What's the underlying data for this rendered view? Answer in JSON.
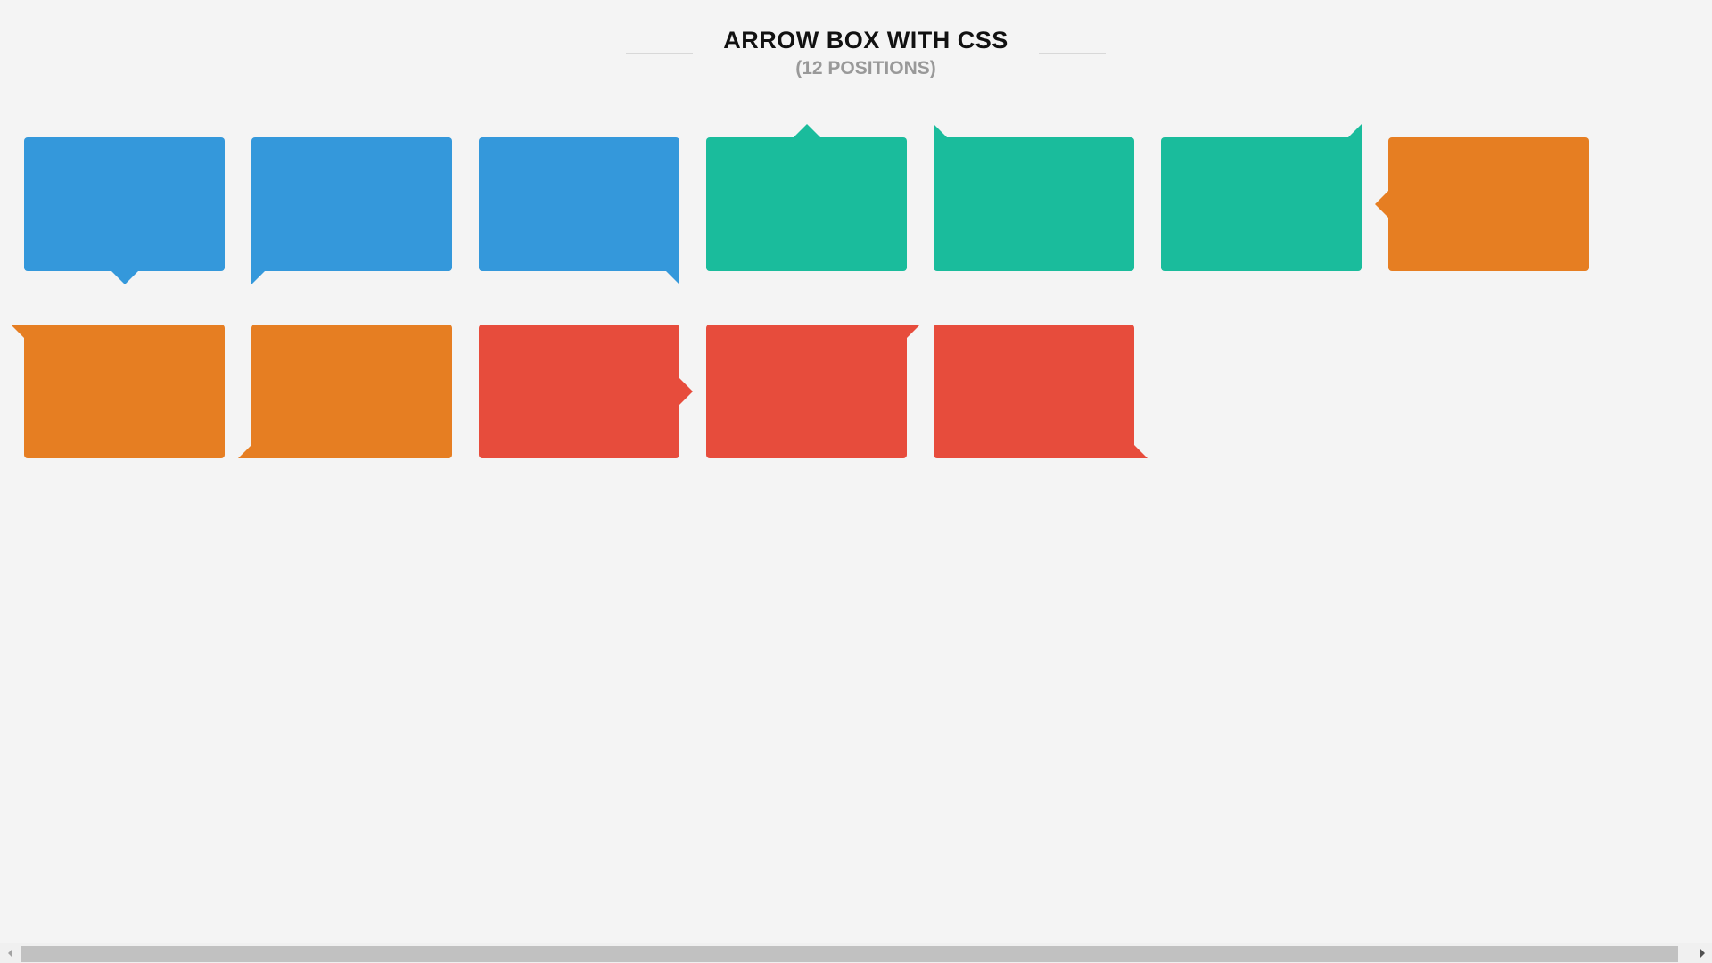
{
  "header": {
    "title": "ARROW BOX WITH CSS",
    "subtitle": "(12 POSITIONS)"
  },
  "colors": {
    "blue": "#3498db",
    "green": "#1abc9c",
    "orange": "#e67e22",
    "red": "#e74c3c",
    "background": "#f4f4f4"
  },
  "boxes": [
    {
      "name": "bottom-center",
      "color": "blue"
    },
    {
      "name": "bottom-left",
      "color": "blue"
    },
    {
      "name": "bottom-right",
      "color": "blue"
    },
    {
      "name": "top-center",
      "color": "green"
    },
    {
      "name": "top-left",
      "color": "green"
    },
    {
      "name": "top-right",
      "color": "green"
    },
    {
      "name": "left-center",
      "color": "orange"
    },
    {
      "name": "left-top",
      "color": "orange"
    },
    {
      "name": "left-bottom",
      "color": "orange"
    },
    {
      "name": "right-center",
      "color": "red"
    },
    {
      "name": "right-top",
      "color": "red"
    },
    {
      "name": "right-bottom",
      "color": "red"
    }
  ]
}
